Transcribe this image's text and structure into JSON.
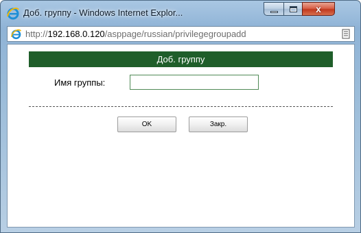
{
  "window": {
    "title": "Доб. группу - Windows Internet Explor...",
    "icon": "ie-logo-icon",
    "caption_buttons": {
      "minimize_icon": "minimize-icon",
      "maximize_icon": "maximize-icon",
      "close_glyph": "x"
    }
  },
  "addressbar": {
    "url_scheme": "http://",
    "url_host": "192.168.0.120",
    "url_path": "/asppage/russian/privilegegroupadd",
    "page_icon": "page-icon"
  },
  "form": {
    "header": "Доб. группу",
    "group_name_label": "Имя группы:",
    "group_name_value": "",
    "ok_label": "OK",
    "close_label": "Закр."
  },
  "colors": {
    "header_bg": "#1f5e2a",
    "input_border": "#4f8a55",
    "close_button": "#c0391f"
  }
}
